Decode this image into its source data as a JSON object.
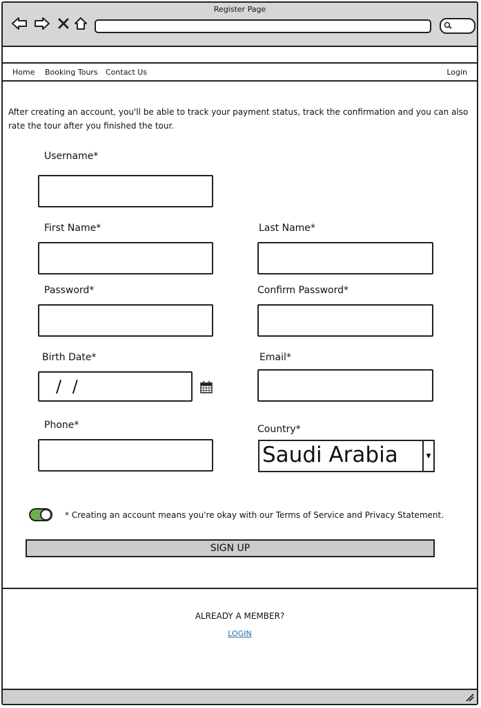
{
  "window": {
    "title": "Register Page"
  },
  "nav": {
    "links": [
      "Home",
      "Booking Tours",
      "Contact Us"
    ],
    "login": "Login"
  },
  "intro": "After creating an account, you'll be able to track your payment status, track the confirmation and you can also rate the tour after you finished the tour.",
  "form": {
    "username": {
      "label": "Username*",
      "value": ""
    },
    "first_name": {
      "label": "First Name*",
      "value": ""
    },
    "last_name": {
      "label": "Last Name*",
      "value": ""
    },
    "password": {
      "label": "Password*",
      "value": ""
    },
    "confirm_password": {
      "label": "Confirm Password*",
      "value": ""
    },
    "birth_date": {
      "label": "Birth Date*",
      "value": "/ /"
    },
    "email": {
      "label": "Email*",
      "value": ""
    },
    "phone": {
      "label": "Phone*",
      "value": ""
    },
    "country": {
      "label": "Country*",
      "value": "Saudi Arabia"
    }
  },
  "terms": {
    "toggle_on": true,
    "toggle_color": "#6ab04c",
    "text": "* Creating an account means you're okay with our Terms of Service and Privacy Statement."
  },
  "signup_label": "SIGN UP",
  "already_member": "ALREADY A MEMBER?",
  "login_link": "LOGIN"
}
